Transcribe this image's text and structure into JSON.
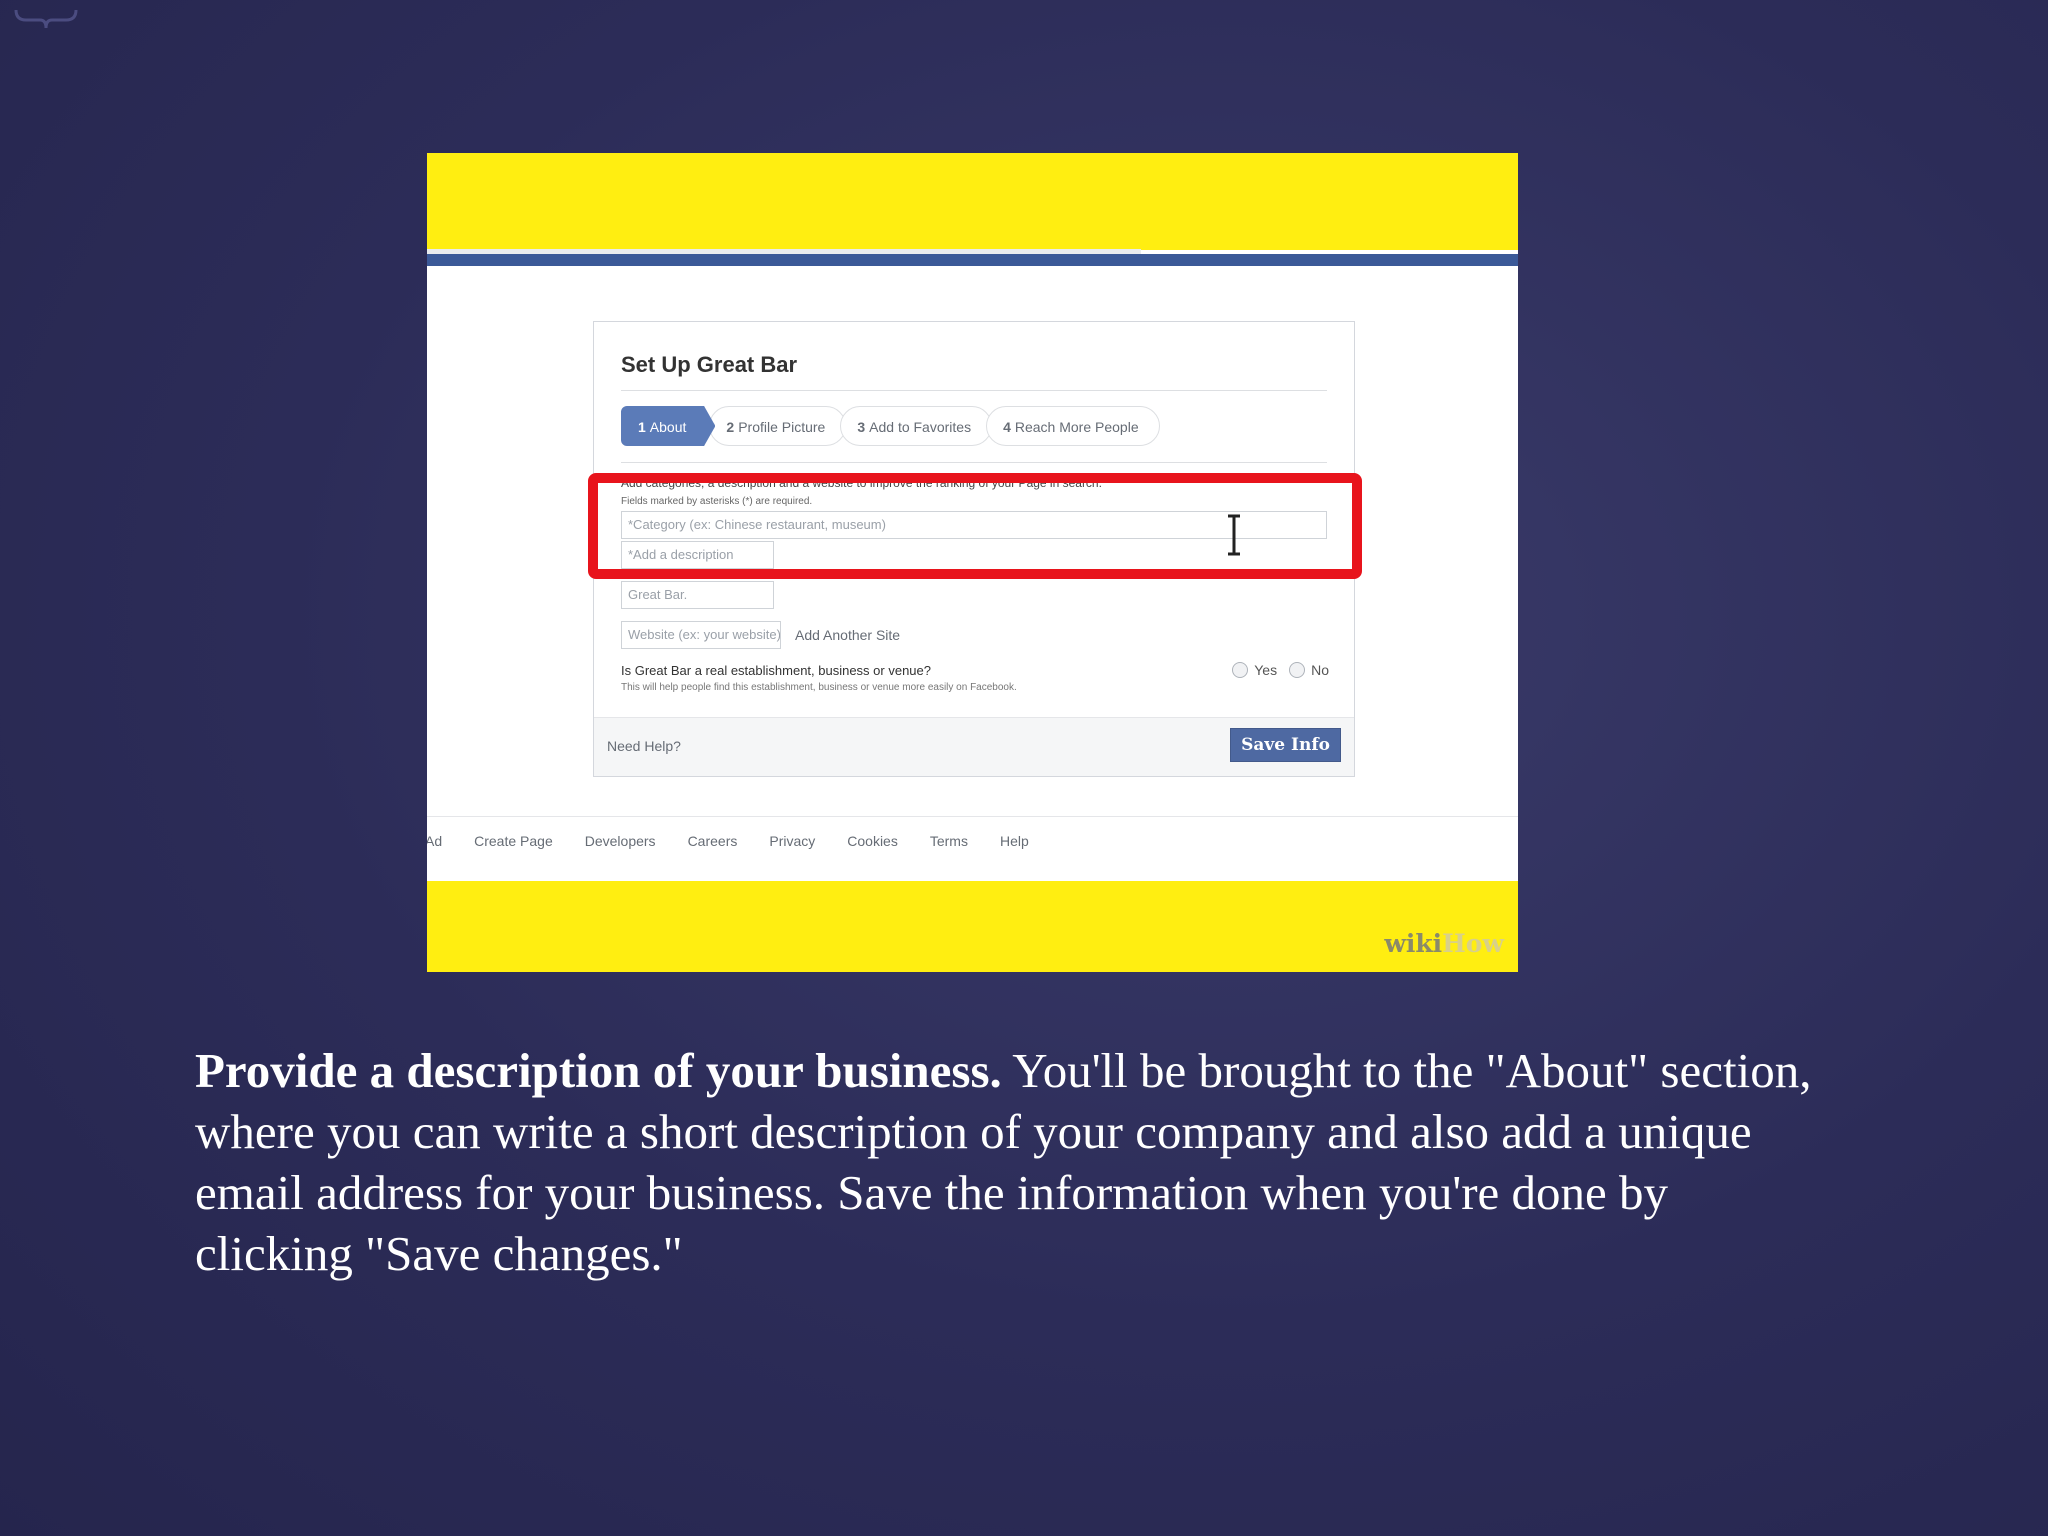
{
  "colors": {
    "background": "#2c2c58",
    "yellow_band": "#ffee11",
    "facebook_blue": "#3b5998",
    "highlight_red": "#e8141c",
    "save_button": "#4e69a2"
  },
  "screenshot": {
    "dialog": {
      "title": "Set Up Great Bar",
      "steps": [
        {
          "number": "1",
          "label": "About",
          "active": true
        },
        {
          "number": "2",
          "label": "Profile Picture",
          "active": false
        },
        {
          "number": "3",
          "label": "Add to Favorites",
          "active": false
        },
        {
          "number": "4",
          "label": "Reach More People",
          "active": false
        }
      ],
      "intro_text": "Add categories, a description and a website to improve the ranking of your Page in search.",
      "required_text": "Fields marked by asterisks (*) are required.",
      "category_placeholder": "*Category (ex: Chinese restaurant, museum)",
      "description_placeholder": "*Add a description",
      "name_value": "Great Bar.",
      "website_placeholder": "Website (ex: your website)",
      "add_site_label": "Add Another Site",
      "question": "Is Great Bar a real establishment, business or venue?",
      "question_note": "This will help people find this establishment, business or venue more easily on Facebook.",
      "radio_yes": "Yes",
      "radio_no": "No",
      "need_help": "Need Help?",
      "save_label": "Save Info"
    },
    "footer_links": [
      "Ad",
      "Create Page",
      "Developers",
      "Careers",
      "Privacy",
      "Cookies",
      "Terms",
      "Help"
    ],
    "logo": {
      "wiki": "wiki",
      "how": "How"
    }
  },
  "caption": {
    "bold": "Provide a description of your business.",
    "text": " You'll be brought to the \"About\" section, where you can write a short description of your company and also add a unique email address for your business. Save the information when you're done by clicking \"Save changes.\""
  }
}
